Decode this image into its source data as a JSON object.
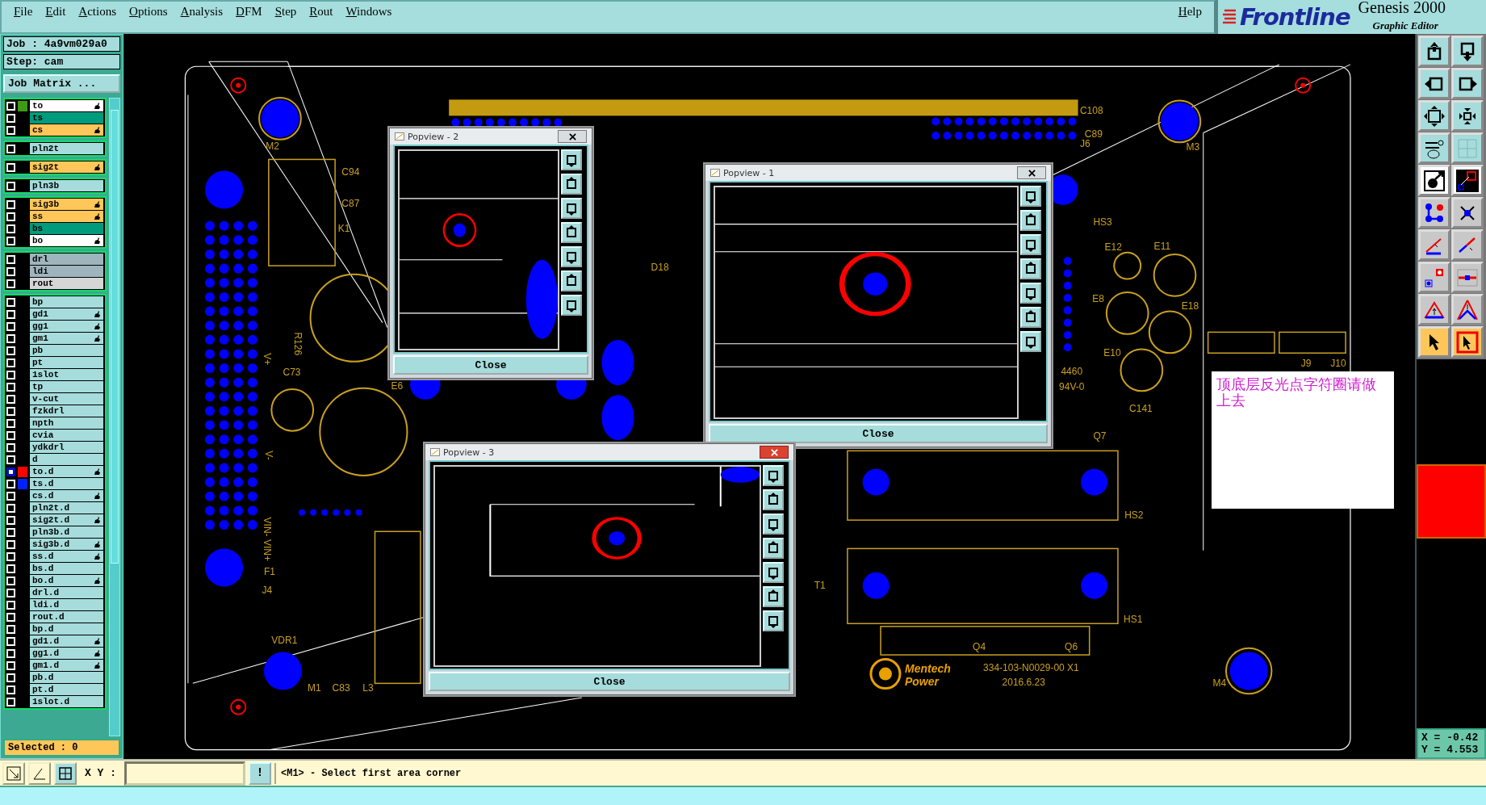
{
  "menu_bar": {
    "items": [
      "File",
      "Edit",
      "Actions",
      "Options",
      "Analysis",
      "DFM",
      "Step",
      "Rout",
      "Windows"
    ],
    "help": "Help"
  },
  "logo": {
    "brand": "Frontline",
    "product": "Genesis 2000",
    "subtitle": "Graphic Editor"
  },
  "job_panel": {
    "job": "Job : 4a9vm029a0",
    "step": "Step: cam",
    "matrix_button": "Job Matrix ...",
    "layer_groups": [
      [
        {
          "name": "to",
          "color": "#ffffff",
          "swatch": {
            "color": "#3c9a14"
          },
          "affected": true,
          "selected": false
        },
        {
          "name": "ts",
          "color": "#009b7c",
          "affected": false,
          "selected": false
        },
        {
          "name": "cs",
          "color": "#ffc65a",
          "affected": true,
          "selected": false
        }
      ],
      [
        {
          "name": "pln2t",
          "color": "#a6dcdc",
          "affected": false,
          "selected": false
        }
      ],
      [
        {
          "name": "sig2t",
          "color": "#ffc65a",
          "affected": true,
          "selected": false
        }
      ],
      [
        {
          "name": "pln3b",
          "color": "#a6dcdc",
          "affected": false,
          "selected": false
        }
      ],
      [
        {
          "name": "sig3b",
          "color": "#ffc65a",
          "affected": true,
          "selected": false
        },
        {
          "name": "ss",
          "color": "#ffc65a",
          "affected": true,
          "selected": false
        },
        {
          "name": "bs",
          "color": "#009b7c",
          "affected": false,
          "selected": false
        },
        {
          "name": "bo",
          "color": "#ffffff",
          "affected": true,
          "selected": false
        }
      ],
      [
        {
          "name": "drl",
          "color": "#9fb5bd",
          "affected": false,
          "selected": false
        },
        {
          "name": "ldi",
          "color": "#9fb5bd",
          "affected": false,
          "selected": false
        },
        {
          "name": "rout",
          "color": "#d6d6d6",
          "affected": false,
          "selected": false
        }
      ],
      [
        {
          "name": "bp",
          "color": "#a6dcdc",
          "affected": false,
          "selected": false
        },
        {
          "name": "gd1",
          "color": "#a6dcdc",
          "affected": true,
          "selected": false
        },
        {
          "name": "gg1",
          "color": "#a6dcdc",
          "affected": true,
          "selected": false
        },
        {
          "name": "gm1",
          "color": "#a6dcdc",
          "affected": true,
          "selected": false
        },
        {
          "name": "pb",
          "color": "#a6dcdc",
          "affected": false,
          "selected": false
        },
        {
          "name": "pt",
          "color": "#a6dcdc",
          "affected": false,
          "selected": false
        },
        {
          "name": "1slot",
          "color": "#a6dcdc",
          "affected": false,
          "selected": false
        },
        {
          "name": "tp",
          "color": "#a6dcdc",
          "affected": false,
          "selected": false
        },
        {
          "name": "v-cut",
          "color": "#a6dcdc",
          "affected": false,
          "selected": false
        },
        {
          "name": "fzkdrl",
          "color": "#a6dcdc",
          "affected": false,
          "selected": false
        },
        {
          "name": "npth",
          "color": "#a6dcdc",
          "affected": false,
          "selected": false
        },
        {
          "name": "cvia",
          "color": "#a6dcdc",
          "affected": false,
          "selected": false
        },
        {
          "name": "ydkdrl",
          "color": "#a6dcdc",
          "affected": false,
          "selected": false
        },
        {
          "name": "d",
          "color": "#a6dcdc",
          "affected": false,
          "selected": false
        },
        {
          "name": "to.d",
          "color": "#a6dcdc",
          "swatch": {
            "color": "#ff0000"
          },
          "affected": true,
          "selected": true
        },
        {
          "name": "ts.d",
          "color": "#a6dcdc",
          "swatch": {
            "color": "#0022ff"
          },
          "affected": false,
          "selected": false
        },
        {
          "name": "cs.d",
          "color": "#a6dcdc",
          "affected": true,
          "selected": false
        },
        {
          "name": "pln2t.d",
          "color": "#a6dcdc",
          "affected": false,
          "selected": false
        },
        {
          "name": "sig2t.d",
          "color": "#a6dcdc",
          "affected": true,
          "selected": false
        },
        {
          "name": "pln3b.d",
          "color": "#a6dcdc",
          "affected": false,
          "selected": false
        },
        {
          "name": "sig3b.d",
          "color": "#a6dcdc",
          "affected": true,
          "selected": false
        },
        {
          "name": "ss.d",
          "color": "#a6dcdc",
          "affected": true,
          "selected": false
        },
        {
          "name": "bs.d",
          "color": "#a6dcdc",
          "affected": false,
          "selected": false
        },
        {
          "name": "bo.d",
          "color": "#a6dcdc",
          "affected": true,
          "selected": false
        },
        {
          "name": "drl.d",
          "color": "#a6dcdc",
          "affected": false,
          "selected": false
        },
        {
          "name": "ldi.d",
          "color": "#a6dcdc",
          "affected": false,
          "selected": false
        },
        {
          "name": "rout.d",
          "color": "#a6dcdc",
          "affected": false,
          "selected": false
        },
        {
          "name": "bp.d",
          "color": "#a6dcdc",
          "affected": false,
          "selected": false
        },
        {
          "name": "gd1.d",
          "color": "#a6dcdc",
          "affected": true,
          "selected": false
        },
        {
          "name": "gg1.d",
          "color": "#a6dcdc",
          "affected": true,
          "selected": false
        },
        {
          "name": "gm1.d",
          "color": "#a6dcdc",
          "affected": true,
          "selected": false
        },
        {
          "name": "pb.d",
          "color": "#a6dcdc",
          "affected": false,
          "selected": false
        },
        {
          "name": "pt.d",
          "color": "#a6dcdc",
          "affected": false,
          "selected": false
        },
        {
          "name": "1slot.d",
          "color": "#a6dcdc",
          "affected": false,
          "selected": false
        }
      ]
    ],
    "selected_count": "Selected : 0"
  },
  "canvas": {
    "labels": [
      "M2",
      "C94",
      "C87",
      "K1",
      "R126",
      "C73",
      "E6",
      "V+",
      "V-",
      "VIN- VIN+",
      "F1",
      "J4",
      "VDR1",
      "M1",
      "C83",
      "L3",
      "D18",
      "HS3",
      "E12",
      "E11",
      "E8",
      "E18",
      "E10",
      "C141",
      "Q7",
      "HS2",
      "HS1",
      "T1",
      "Q4",
      "Q6",
      "M3",
      "M4",
      "J6",
      "J9",
      "J10",
      "C108",
      "C89",
      "4460",
      "94V-0",
      "334-103-N0029-00 X1",
      "2016.6.23"
    ],
    "logo_text": [
      "Mentech",
      "Power"
    ],
    "note": "顶底层反光点字符圈请做上去",
    "popviews": [
      {
        "title": "Popview - 2",
        "active": false,
        "close_button": "Close"
      },
      {
        "title": "Popview - 1",
        "active": false,
        "close_button": "Close"
      },
      {
        "title": "Popview - 3",
        "active": true,
        "close_button": "Close"
      }
    ]
  },
  "coordinates": {
    "x": "X = -0.42",
    "y": "Y = 4.553"
  },
  "command_bar": {
    "xy_label": "X Y :",
    "warn_button": "!",
    "prompt": "<M1> - Select first area corner"
  }
}
